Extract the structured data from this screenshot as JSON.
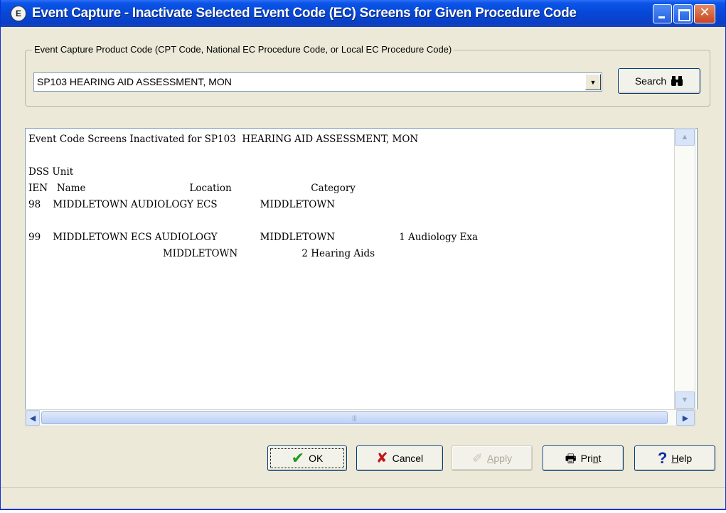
{
  "window": {
    "title": "Event Capture - Inactivate Selected Event Code (EC) Screens for Given Procedure Code",
    "app_icon_glyph": "E"
  },
  "procedure": {
    "group_label": "Event Capture Product Code (CPT Code, National EC Procedure Code, or Local EC Procedure Code)",
    "selected_value": "SP103  HEARING AID ASSESSMENT, MON",
    "search_label": "Search"
  },
  "report": {
    "text_lines": [
      "Event Code Screens Inactivated for SP103  HEARING AID ASSESSMENT, MON",
      "",
      "DSS Unit",
      "IEN   Name                                  Location                          Category",
      "98    MIDDLETOWN AUDIOLOGY ECS              MIDDLETOWN",
      "",
      "99    MIDDLETOWN ECS AUDIOLOGY              MIDDLETOWN                     1 Audiology Exa",
      "                                            MIDDLETOWN                     2 Hearing Aids"
    ]
  },
  "buttons": {
    "ok": "OK",
    "cancel": "Cancel",
    "apply_prefix": "",
    "apply_underline": "A",
    "apply_rest": "pply",
    "print_prefix": "Pri",
    "print_underline": "n",
    "print_rest": "t",
    "help_prefix": "",
    "help_underline": "H",
    "help_rest": "elp"
  },
  "icons": {
    "ok": "checkmark-icon",
    "cancel": "x-icon",
    "apply": "wand-icon",
    "print": "printer-icon",
    "help": "question-icon",
    "search": "binoculars-icon"
  },
  "colors": {
    "titlebar": "#0a55e8",
    "window_bg": "#ece9d8",
    "ok_check": "#1f9a1f",
    "cancel_x": "#c01818"
  }
}
